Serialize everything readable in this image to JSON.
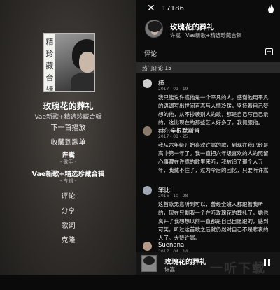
{
  "left": {
    "cover_vertical_text": [
      "珍",
      "藏",
      "合",
      "辑"
    ],
    "cover_top_text": "精",
    "title": "玫瑰花的葬礼",
    "subtitle": "Vae新歌+精选珍藏合辑",
    "menu": {
      "next": "下一首播放",
      "favorite": "收藏到歌单",
      "artist_name": "许嵩",
      "artist_role": "- 歌手 -",
      "album_name": "Vae新歌+精选珍藏合辑",
      "album_role": "- 专辑 -",
      "comment": "评论",
      "share": "分享",
      "lyrics": "歌词",
      "clone": "克隆"
    }
  },
  "right": {
    "close_icon": "close-icon",
    "comment_count": "17186",
    "song_title": "玫瑰花的葬礼",
    "song_sub": "许嵩 | Vae新歌+精选珍藏合辑",
    "comment_label": "评论",
    "hot_label": "热门评论 15",
    "comments": [
      {
        "user": "樺.",
        "date": "2017 - 01 - 19",
        "text": "我只能说许嵩他是一个平凡的人，感谢他用平凡的语调写出世间百态与人情冷暖，坚持着自己梦想的他，从不抄袭别人的歌，都是自己写自己录的，这比现在的那些艺人好多了，我佩服他。"
      },
      {
        "user": "赫尔辛根默斯肯",
        "date": "2017 - 01 - 25",
        "text": "我从六年级开始喜欢许嵩的歌，到现在我已经是高中第一年了。我一直把六年级喜欢的人的照留心事藏在许嵩的歌里来听，我被追了那个人五年，我藏不住了，过为今后的回忆，只要听许嵩的歌，可明明还是那么熟悉的感觉，听许嵩，坏的，听，第七年，我很想还的新歌，并且一直喜欢许嵩的歌。"
      },
      {
        "user": "笨比.",
        "date": "2016 - 10 - 28",
        "text": "这首歌无意听到可以，曾经全班人都跟着我听的，现在只剩我一个在听玫瑰花的葬礼了，她也离开了我想想以前一直都是自己自愿跟的，感到可笑，听过这首歌之后就仍然对自己不是悲哀的人了。大赞许嵩。"
      },
      {
        "user": "Suenana",
        "date": "2017 - 04 - 14",
        "text": ""
      }
    ]
  },
  "player": {
    "title": "玫瑰花的葬礼",
    "artist": "许嵩"
  },
  "watermark": "一听下载"
}
